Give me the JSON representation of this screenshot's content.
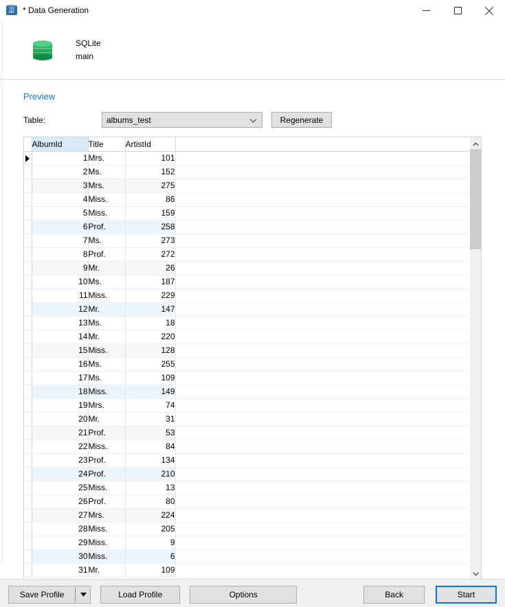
{
  "window": {
    "title": "* Data Generation",
    "icon": "data-generation-icon",
    "icon_text": "101\nABC",
    "controls": {
      "minimize": "minimize-icon",
      "maximize": "maximize-icon",
      "close": "close-icon"
    }
  },
  "connection": {
    "icon": "database-cylinder-icon",
    "engine": "SQLite",
    "schema": "main"
  },
  "preview": {
    "heading": "Preview",
    "table_label": "Table:",
    "table_value": "albums_test",
    "table_options": [
      "albums_test"
    ],
    "regenerate_label": "Regenerate",
    "dropdown_icon": "chevron-down-icon"
  },
  "grid": {
    "columns": [
      "AlbumId",
      "Title",
      "ArtistId"
    ],
    "highlighted_column": "AlbumId",
    "selected_row": 1,
    "rows": [
      {
        "AlbumId": "1",
        "Title": "Mrs.",
        "ArtistId": "101"
      },
      {
        "AlbumId": "2",
        "Title": "Ms.",
        "ArtistId": "152"
      },
      {
        "AlbumId": "3",
        "Title": "Mrs.",
        "ArtistId": "275"
      },
      {
        "AlbumId": "4",
        "Title": "Miss.",
        "ArtistId": "86"
      },
      {
        "AlbumId": "5",
        "Title": "Miss.",
        "ArtistId": "159"
      },
      {
        "AlbumId": "6",
        "Title": "Prof.",
        "ArtistId": "258"
      },
      {
        "AlbumId": "7",
        "Title": "Ms.",
        "ArtistId": "273"
      },
      {
        "AlbumId": "8",
        "Title": "Prof.",
        "ArtistId": "272"
      },
      {
        "AlbumId": "9",
        "Title": "Mr.",
        "ArtistId": "26"
      },
      {
        "AlbumId": "10",
        "Title": "Ms.",
        "ArtistId": "187"
      },
      {
        "AlbumId": "11",
        "Title": "Miss.",
        "ArtistId": "229"
      },
      {
        "AlbumId": "12",
        "Title": "Mr.",
        "ArtistId": "147"
      },
      {
        "AlbumId": "13",
        "Title": "Ms.",
        "ArtistId": "18"
      },
      {
        "AlbumId": "14",
        "Title": "Mr.",
        "ArtistId": "220"
      },
      {
        "AlbumId": "15",
        "Title": "Miss.",
        "ArtistId": "128"
      },
      {
        "AlbumId": "16",
        "Title": "Ms.",
        "ArtistId": "255"
      },
      {
        "AlbumId": "17",
        "Title": "Ms.",
        "ArtistId": "109"
      },
      {
        "AlbumId": "18",
        "Title": "Miss.",
        "ArtistId": "149"
      },
      {
        "AlbumId": "19",
        "Title": "Mrs.",
        "ArtistId": "74"
      },
      {
        "AlbumId": "20",
        "Title": "Mr.",
        "ArtistId": "31"
      },
      {
        "AlbumId": "21",
        "Title": "Prof.",
        "ArtistId": "53"
      },
      {
        "AlbumId": "22",
        "Title": "Miss.",
        "ArtistId": "84"
      },
      {
        "AlbumId": "23",
        "Title": "Prof.",
        "ArtistId": "134"
      },
      {
        "AlbumId": "24",
        "Title": "Prof.",
        "ArtistId": "210"
      },
      {
        "AlbumId": "25",
        "Title": "Miss.",
        "ArtistId": "13"
      },
      {
        "AlbumId": "26",
        "Title": "Prof.",
        "ArtistId": "80"
      },
      {
        "AlbumId": "27",
        "Title": "Mrs.",
        "ArtistId": "224"
      },
      {
        "AlbumId": "28",
        "Title": "Miss.",
        "ArtistId": "205"
      },
      {
        "AlbumId": "29",
        "Title": "Miss.",
        "ArtistId": "9"
      },
      {
        "AlbumId": "30",
        "Title": "Miss.",
        "ArtistId": "6"
      },
      {
        "AlbumId": "31",
        "Title": "Mr.",
        "ArtistId": "109"
      }
    ],
    "tint_blue_rows": [
      6,
      12,
      18,
      24,
      30
    ],
    "tint_gray_rows": [
      3,
      9,
      15,
      21,
      27
    ]
  },
  "scrollbar": {
    "up_icon": "chevron-up-icon",
    "down_icon": "chevron-down-icon"
  },
  "footer": {
    "save_profile": "Save Profile",
    "save_profile_arrow": "triangle-down-icon",
    "load_profile": "Load Profile",
    "options": "Options",
    "back": "Back",
    "start": "Start"
  },
  "colors": {
    "accent": "#0078d7",
    "preview_heading": "#1579c0",
    "column_highlight": "#d9ebf9",
    "row_tint_blue": "#edf5fc",
    "row_tint_gray": "#f6f6f6",
    "db_green": "#23ab5e"
  }
}
